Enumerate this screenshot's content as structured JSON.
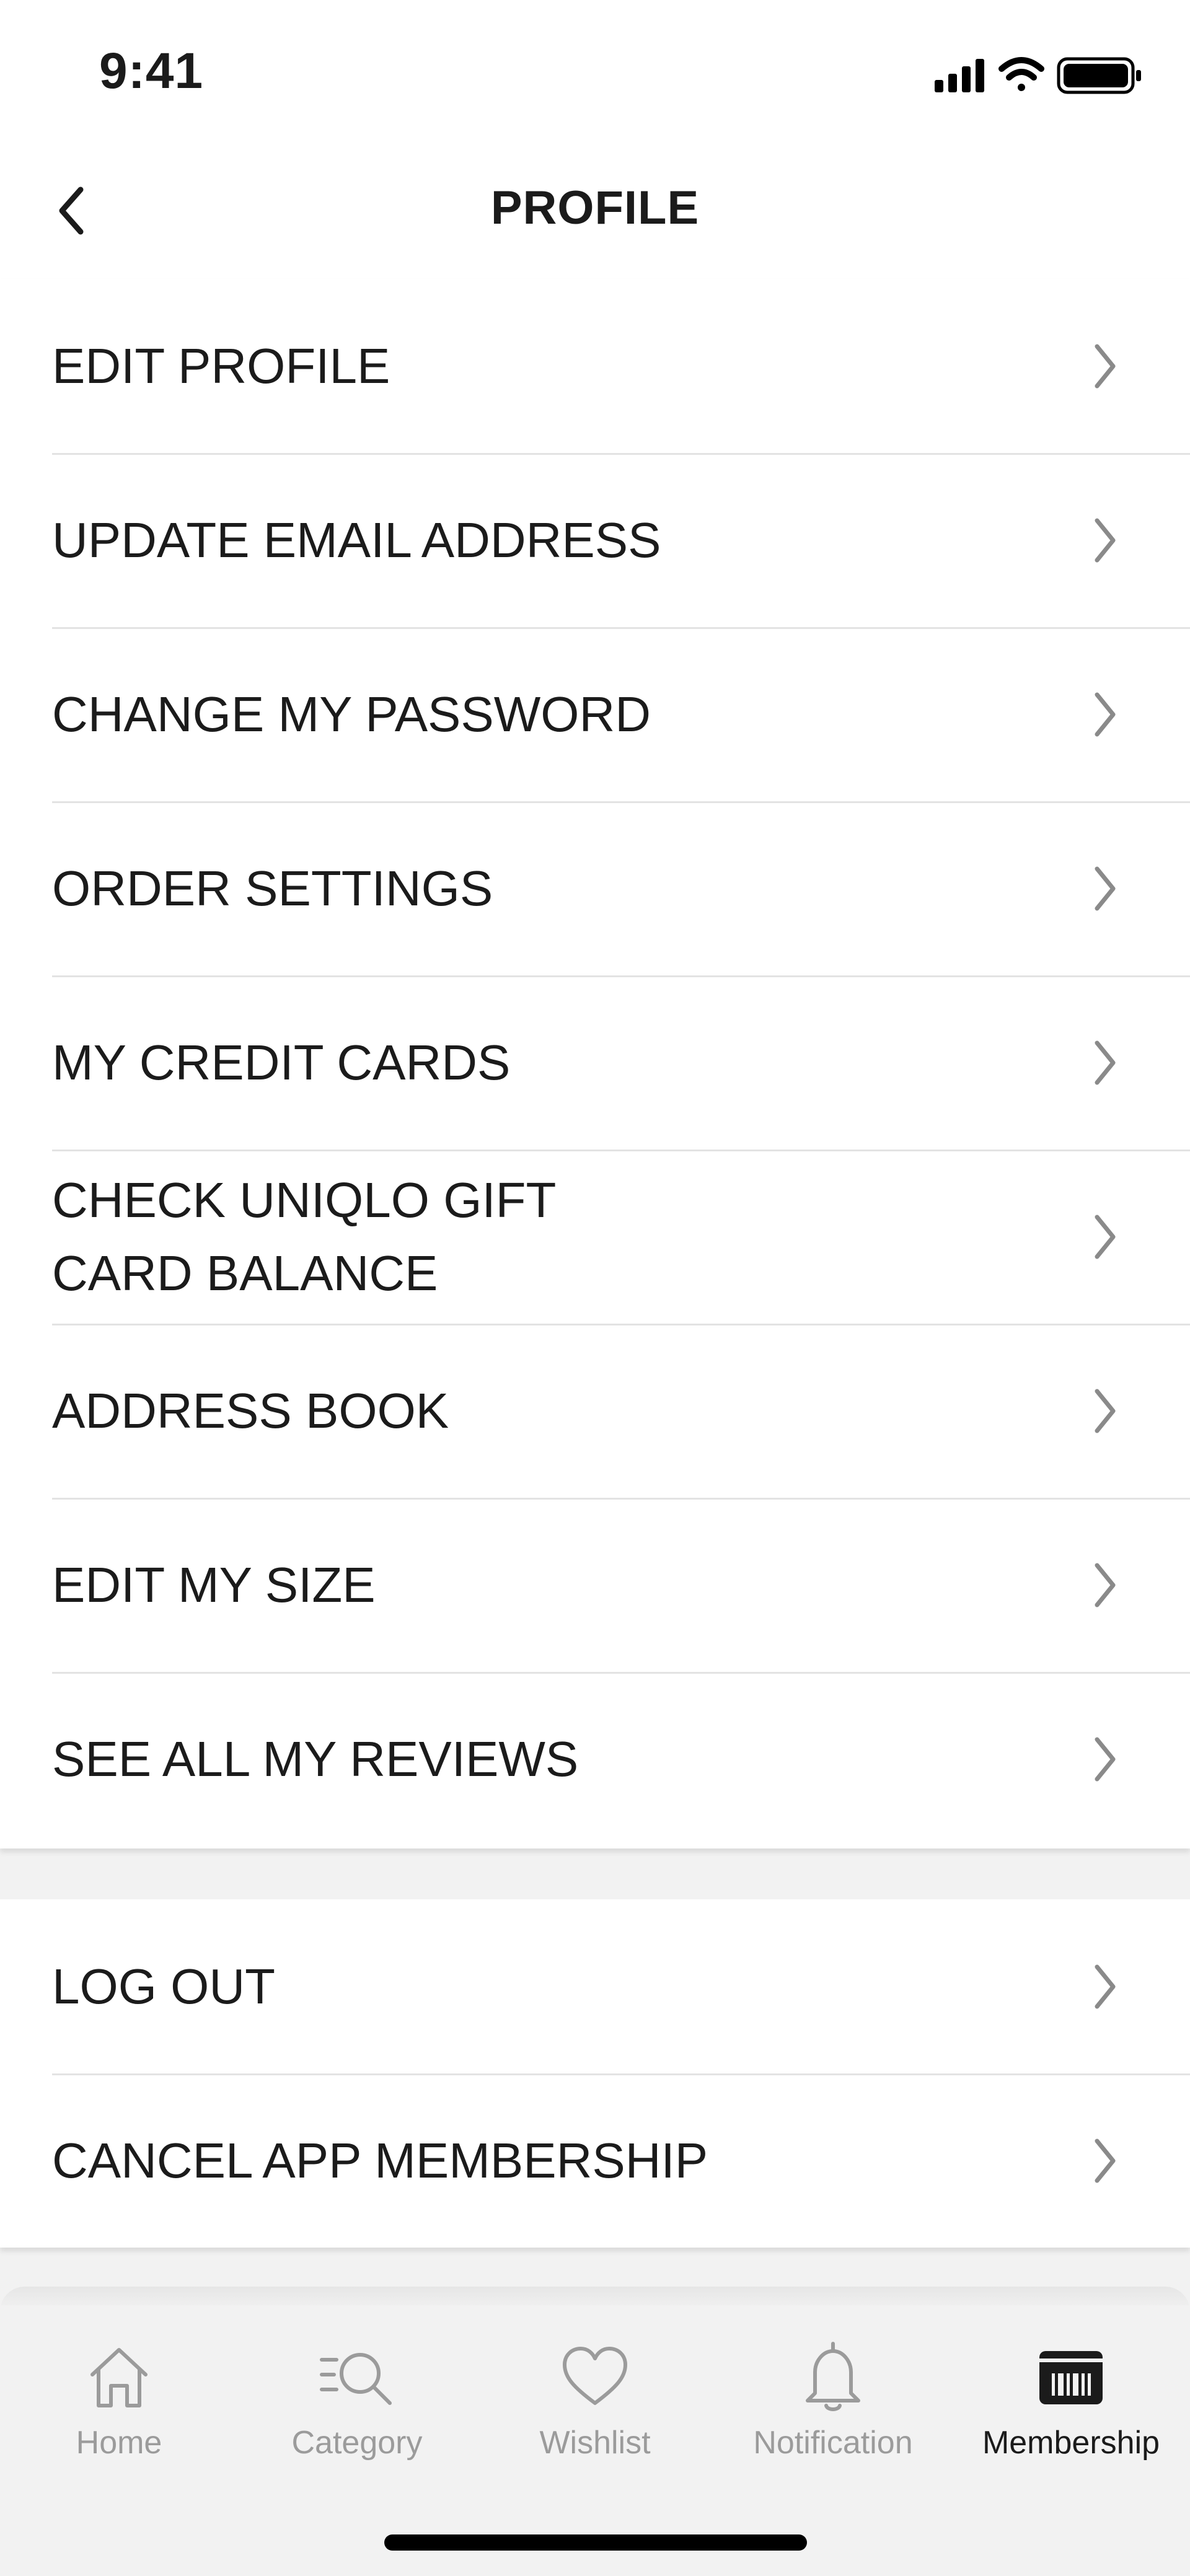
{
  "status_bar": {
    "time": "9:41"
  },
  "header": {
    "title": "PROFILE"
  },
  "menu_groups": [
    {
      "items": [
        {
          "label": "EDIT PROFILE"
        },
        {
          "label": "UPDATE EMAIL ADDRESS"
        },
        {
          "label": "CHANGE MY PASSWORD"
        },
        {
          "label": "ORDER SETTINGS"
        },
        {
          "label": "MY CREDIT CARDS"
        },
        {
          "label": "CHECK UNIQLO GIFT CARD BALANCE"
        },
        {
          "label": "ADDRESS BOOK"
        },
        {
          "label": "EDIT MY SIZE"
        },
        {
          "label": "SEE ALL MY REVIEWS"
        }
      ]
    },
    {
      "items": [
        {
          "label": "LOG OUT"
        },
        {
          "label": "CANCEL APP MEMBERSHIP"
        }
      ]
    }
  ],
  "tab_bar": {
    "active": "Membership",
    "tabs": [
      {
        "label": "Home",
        "icon": "home-icon"
      },
      {
        "label": "Category",
        "icon": "category-search-icon"
      },
      {
        "label": "Wishlist",
        "icon": "heart-icon"
      },
      {
        "label": "Notification",
        "icon": "bell-icon"
      },
      {
        "label": "Membership",
        "icon": "membership-card-icon"
      }
    ]
  },
  "colors": {
    "text": "#1b1b1b",
    "inactive_tab": "#9b9b9b",
    "chevron": "#8a8a8a",
    "divider": "#e3e3e3",
    "background": "#f2f2f2"
  }
}
